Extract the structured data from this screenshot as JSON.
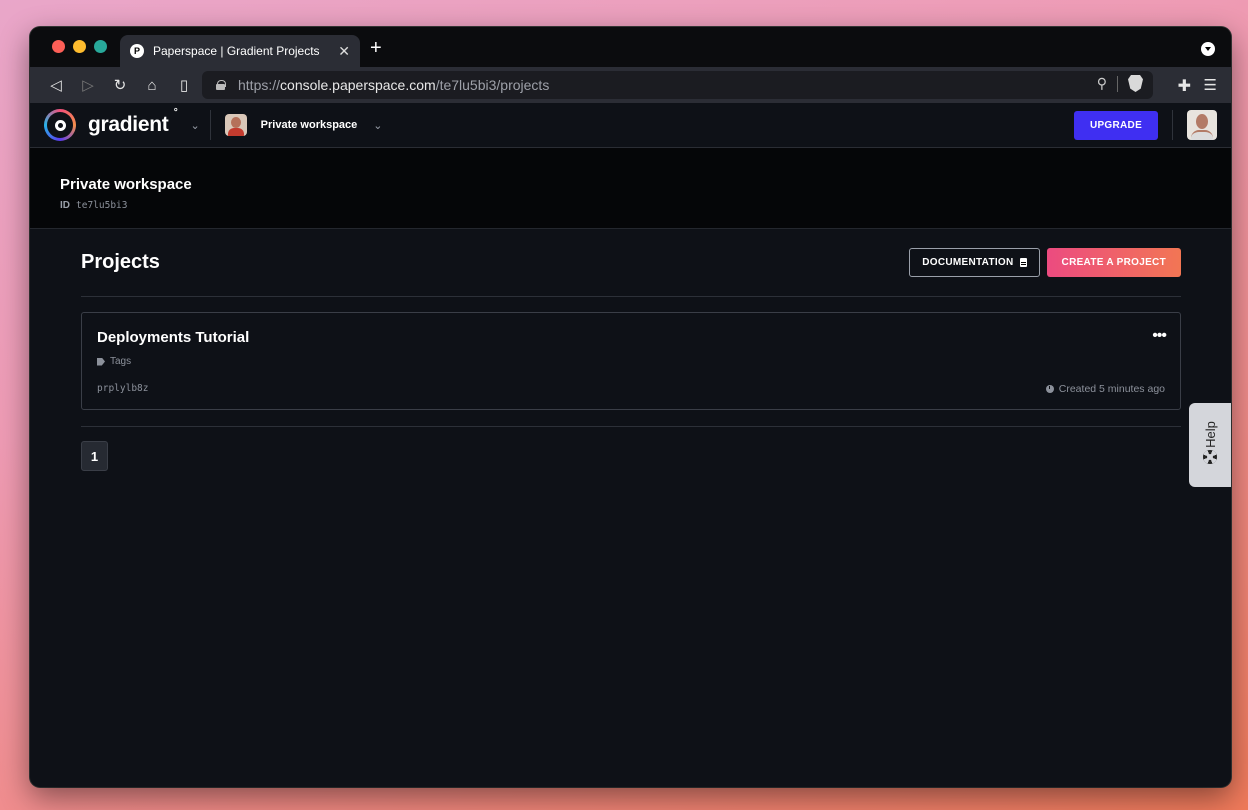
{
  "browser": {
    "tab_title": "Paperspace | Gradient Projects",
    "favicon_letter": "P",
    "url_scheme": "https://",
    "url_host": "console.paperspace.com",
    "url_path": "/te7lu5bi3/projects"
  },
  "app": {
    "logo_text": "gradient",
    "workspace_name": "Private workspace",
    "upgrade_label": "UPGRADE"
  },
  "banner": {
    "title": "Private workspace",
    "id_label": "ID",
    "id_value": "te7lu5bi3"
  },
  "projects": {
    "title": "Projects",
    "documentation_label": "DOCUMENTATION",
    "create_label": "CREATE A PROJECT",
    "items": [
      {
        "name": "Deployments Tutorial",
        "tags_label": "Tags",
        "id": "prplylb8z",
        "created": "Created 5 minutes ago"
      }
    ],
    "pagination": {
      "current_page": "1"
    }
  },
  "help": {
    "label": "Help"
  },
  "colors": {
    "accent_primary": "#3f2ff2",
    "accent_gradient_start": "#ec4b80",
    "accent_gradient_end": "#f27654",
    "background": "#0e1117"
  }
}
